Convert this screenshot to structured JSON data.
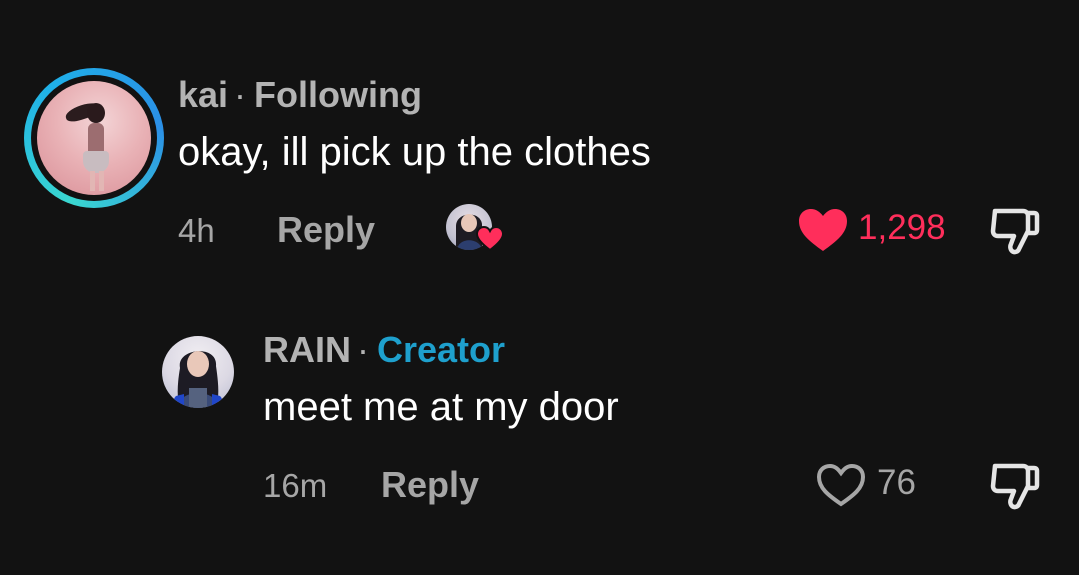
{
  "comments": [
    {
      "username": "kai",
      "separator": "·",
      "relation": "Following",
      "text": "okay, ill pick up the clothes",
      "time": "4h",
      "reply_label": "Reply",
      "like_count": "1,298",
      "liked": true,
      "creator_liked": true,
      "avatar_icon": "user-avatar-photo",
      "like_icon": "heart-filled-icon",
      "dislike_icon": "thumbs-down-icon"
    },
    {
      "username": "RAIN",
      "separator": "·",
      "relation": "Creator",
      "text": "meet me at my door",
      "time": "16m",
      "reply_label": "Reply",
      "like_count": "76",
      "liked": false,
      "avatar_icon": "creator-avatar-photo",
      "like_icon": "heart-outline-icon",
      "dislike_icon": "thumbs-down-icon"
    }
  ],
  "colors": {
    "background": "#121212",
    "like_active": "#ff2e5b",
    "creator_badge": "#1ea0cd",
    "muted_text": "#b3b3b3",
    "story_ring": "#1fb0e8"
  }
}
